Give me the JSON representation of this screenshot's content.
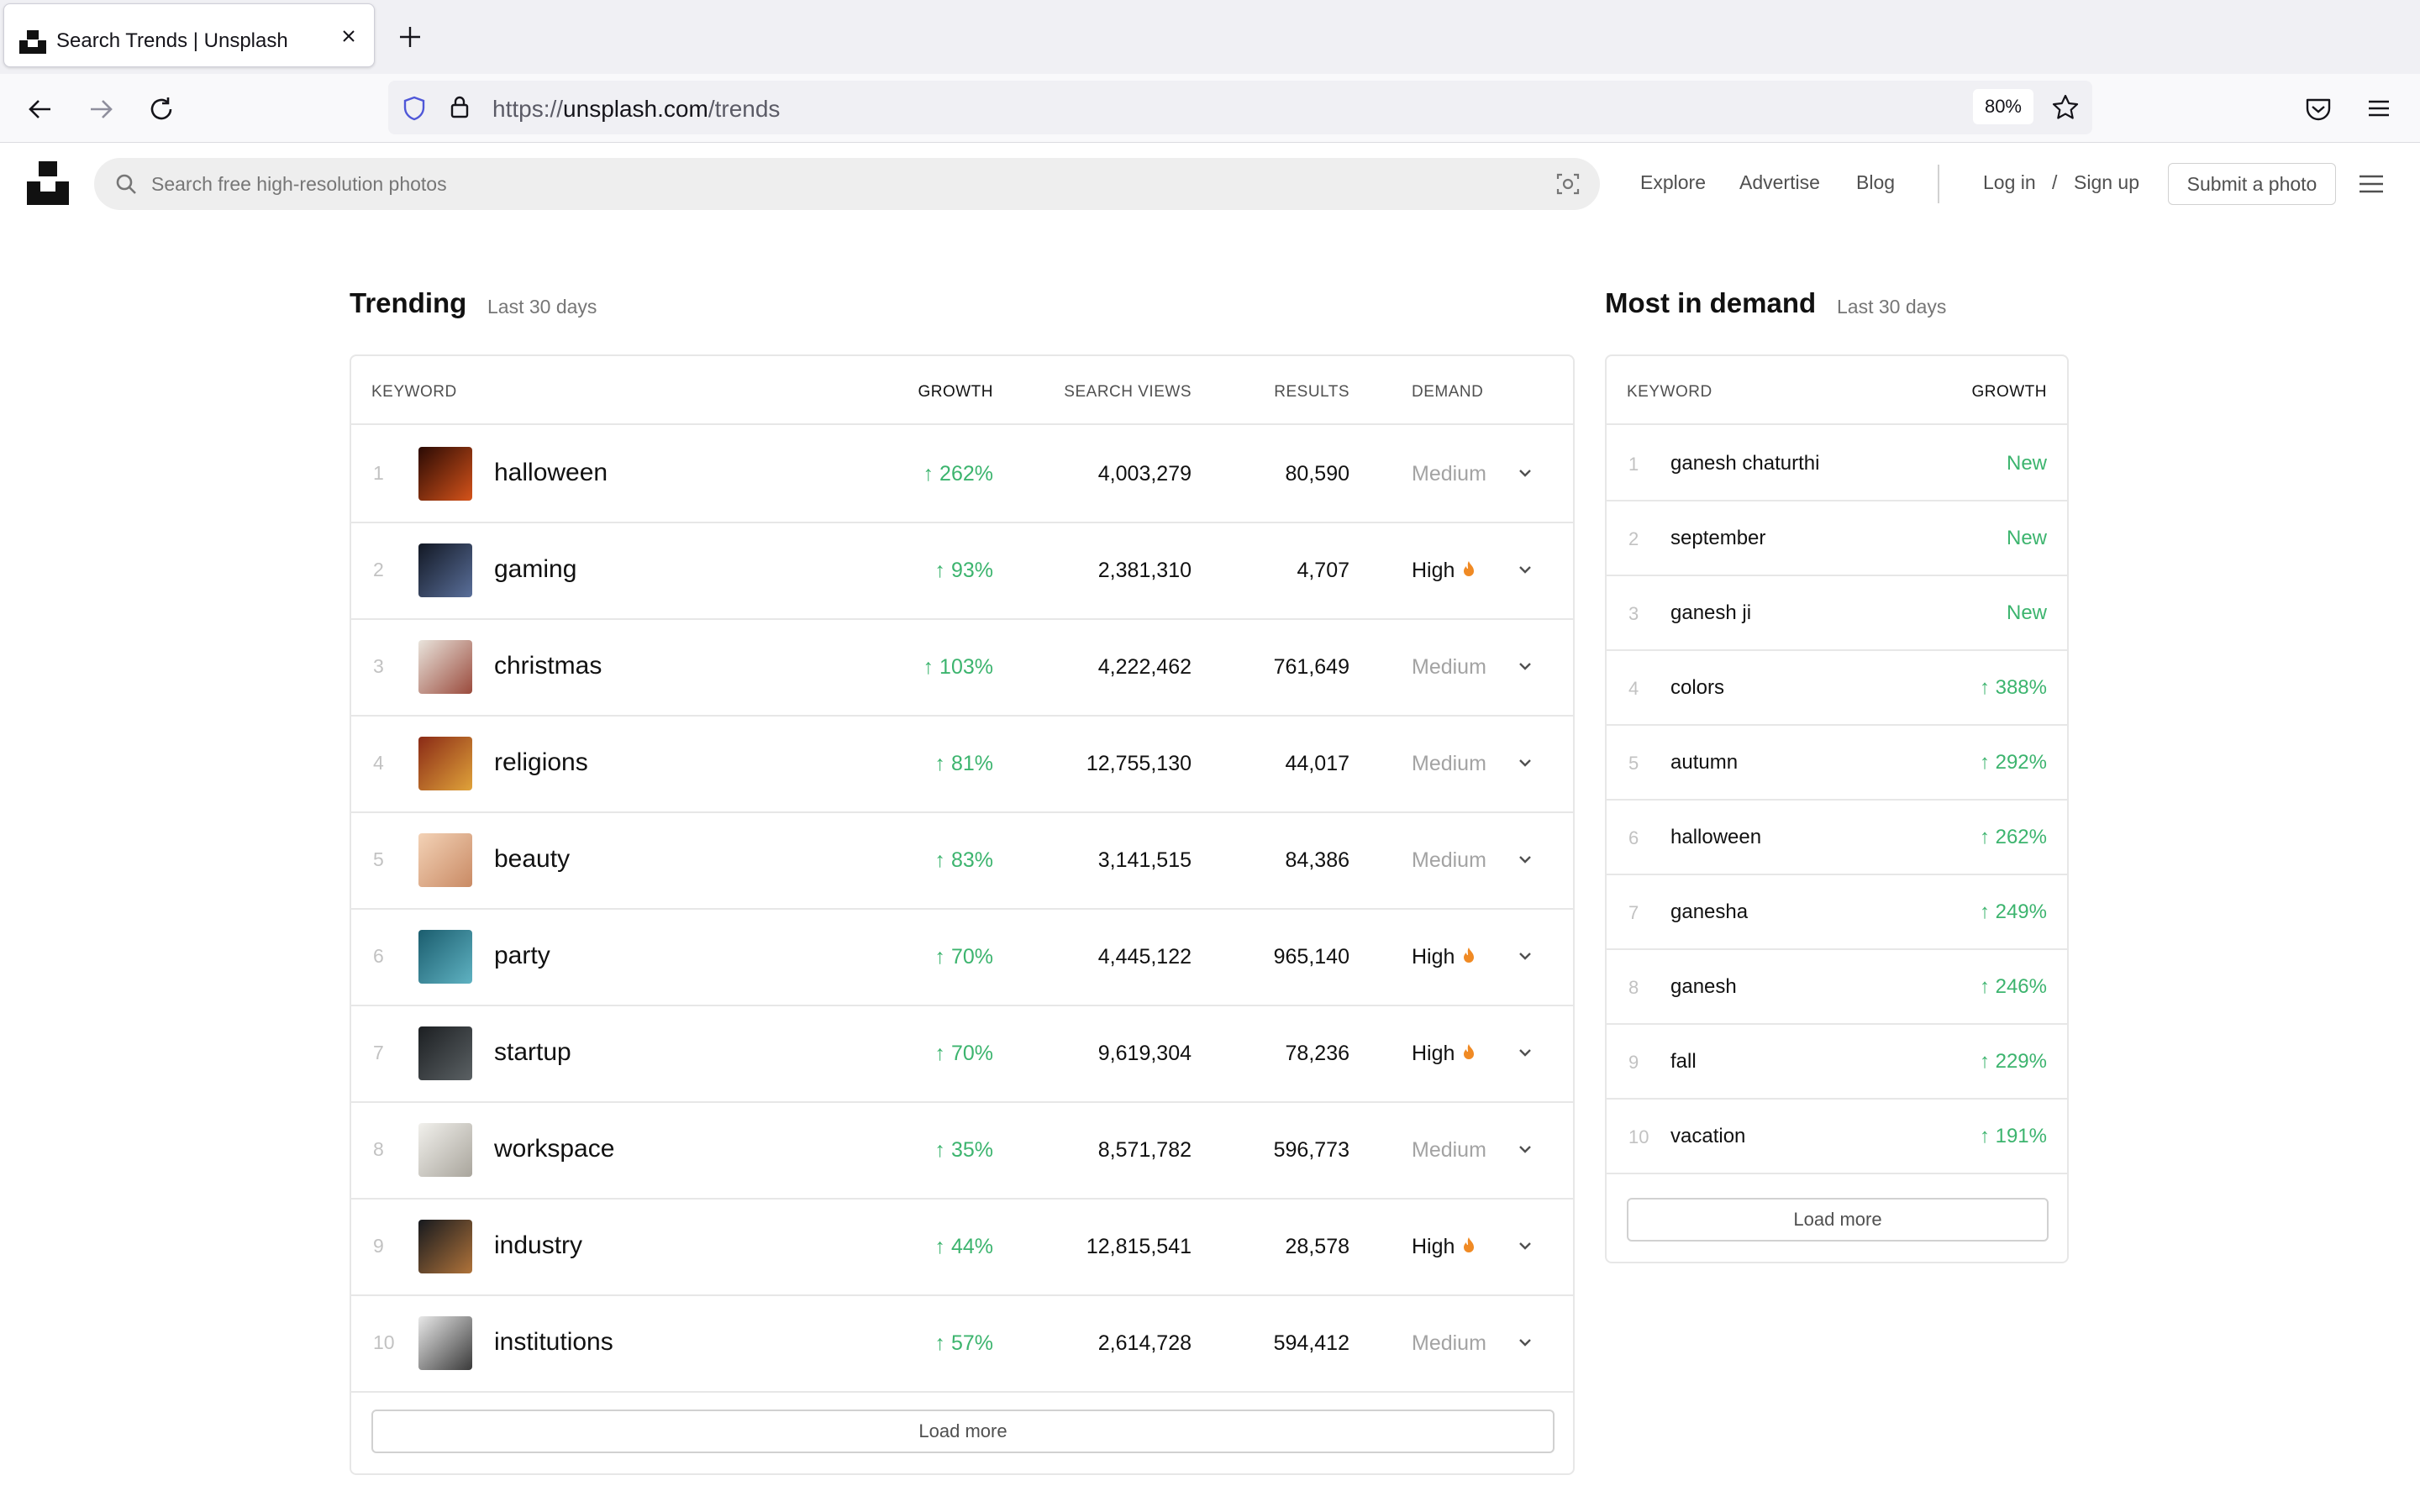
{
  "browser": {
    "tab_title": "Search Trends | Unsplash",
    "url_scheme": "https://",
    "url_host": "unsplash.com",
    "url_path": "/trends",
    "zoom": "80%"
  },
  "header": {
    "search_placeholder": "Search free high-resolution photos",
    "nav": {
      "explore": "Explore",
      "advertise": "Advertise",
      "blog": "Blog"
    },
    "login": "Log in",
    "separator": "/",
    "signup": "Sign up",
    "submit": "Submit a photo"
  },
  "trending": {
    "title": "Trending",
    "subtitle": "Last 30 days",
    "columns": {
      "keyword": "KEYWORD",
      "growth": "GROWTH",
      "views": "SEARCH VIEWS",
      "results": "RESULTS",
      "demand": "DEMAND"
    },
    "rows": [
      {
        "rank": "1",
        "keyword": "halloween",
        "growth": "↑ 262%",
        "views": "4,003,279",
        "results": "80,590",
        "demand": "Medium",
        "high": false,
        "thumb": [
          "#2a0a04",
          "#d5531a"
        ]
      },
      {
        "rank": "2",
        "keyword": "gaming",
        "growth": "↑ 93%",
        "views": "2,381,310",
        "results": "4,707",
        "demand": "High",
        "high": true,
        "thumb": [
          "#121824",
          "#5a6f9a"
        ]
      },
      {
        "rank": "3",
        "keyword": "christmas",
        "growth": "↑ 103%",
        "views": "4,222,462",
        "results": "761,649",
        "demand": "Medium",
        "high": false,
        "thumb": [
          "#e9e4dc",
          "#9a4a3c"
        ]
      },
      {
        "rank": "4",
        "keyword": "religions",
        "growth": "↑ 81%",
        "views": "12,755,130",
        "results": "44,017",
        "demand": "Medium",
        "high": false,
        "thumb": [
          "#8a2a16",
          "#e0a33a"
        ]
      },
      {
        "rank": "5",
        "keyword": "beauty",
        "growth": "↑ 83%",
        "views": "3,141,515",
        "results": "84,386",
        "demand": "Medium",
        "high": false,
        "thumb": [
          "#f3d2b6",
          "#c98a64"
        ]
      },
      {
        "rank": "6",
        "keyword": "party",
        "growth": "↑ 70%",
        "views": "4,445,122",
        "results": "965,140",
        "demand": "High",
        "high": true,
        "thumb": [
          "#1b5d6e",
          "#5fb2c2"
        ]
      },
      {
        "rank": "7",
        "keyword": "startup",
        "growth": "↑ 70%",
        "views": "9,619,304",
        "results": "78,236",
        "demand": "High",
        "high": true,
        "thumb": [
          "#1c1f22",
          "#5b6164"
        ]
      },
      {
        "rank": "8",
        "keyword": "workspace",
        "growth": "↑ 35%",
        "views": "8,571,782",
        "results": "596,773",
        "demand": "Medium",
        "high": false,
        "thumb": [
          "#f1f0ec",
          "#a9a59c"
        ]
      },
      {
        "rank": "9",
        "keyword": "industry",
        "growth": "↑ 44%",
        "views": "12,815,541",
        "results": "28,578",
        "demand": "High",
        "high": true,
        "thumb": [
          "#16191e",
          "#b0733a"
        ]
      },
      {
        "rank": "10",
        "keyword": "institutions",
        "growth": "↑ 57%",
        "views": "2,614,728",
        "results": "594,412",
        "demand": "Medium",
        "high": false,
        "thumb": [
          "#e8e8e8",
          "#3a3a3a"
        ]
      }
    ],
    "load_more": "Load more"
  },
  "demand": {
    "title": "Most in demand",
    "subtitle": "Last 30 days",
    "columns": {
      "keyword": "KEYWORD",
      "growth": "GROWTH"
    },
    "rows": [
      {
        "rank": "1",
        "keyword": "ganesh chaturthi",
        "growth": "New"
      },
      {
        "rank": "2",
        "keyword": "september",
        "growth": "New"
      },
      {
        "rank": "3",
        "keyword": "ganesh ji",
        "growth": "New"
      },
      {
        "rank": "4",
        "keyword": "colors",
        "growth": "↑ 388%"
      },
      {
        "rank": "5",
        "keyword": "autumn",
        "growth": "↑ 292%"
      },
      {
        "rank": "6",
        "keyword": "halloween",
        "growth": "↑ 262%"
      },
      {
        "rank": "7",
        "keyword": "ganesha",
        "growth": "↑ 249%"
      },
      {
        "rank": "8",
        "keyword": "ganesh",
        "growth": "↑ 246%"
      },
      {
        "rank": "9",
        "keyword": "fall",
        "growth": "↑ 229%"
      },
      {
        "rank": "10",
        "keyword": "vacation",
        "growth": "↑ 191%"
      }
    ],
    "load_more": "Load more"
  },
  "colors": {
    "growth_green": "#3cb46e",
    "muted": "#a3a3a3",
    "fire": "#f08a24"
  },
  "icons": [
    "unsplash-logo",
    "close-icon",
    "plus-icon",
    "back-icon",
    "forward-icon",
    "reload-icon",
    "shield-icon",
    "lock-icon",
    "star-icon",
    "pocket-icon",
    "menu-icon",
    "search-icon",
    "visual-search-icon",
    "fire-icon",
    "chevron-down-icon"
  ]
}
